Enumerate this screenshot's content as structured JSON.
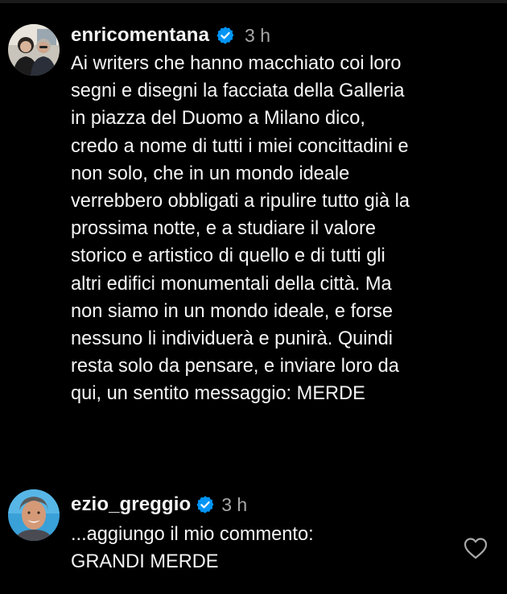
{
  "theme": {
    "background": "#000000",
    "text": "#f5f5f5",
    "muted": "#a8a8a8",
    "verified_blue": "#0095f6"
  },
  "comments": [
    {
      "username": "enricomentana",
      "verified": true,
      "verified_icon": "verified-badge-icon",
      "time": "3 h",
      "text": "Ai writers che hanno macchiato coi loro\nsegni e disegni la facciata della Galleria\nin piazza del Duomo a Milano dico,\ncredo a nome di tutti i miei concittadini e\nnon solo, che in un mondo ideale\nverrebbero obbligati a ripulire tutto già la\nprossima notte, e a studiare il valore\nstorico e artistico di quello e di tutti gli\naltri edifici monumentali della città. Ma\nnon siamo in un mondo ideale, e forse\nnessuno li individuerà e punirà. Quindi\nresta solo da pensare, e inviare loro da\nqui, un sentito messaggio: MERDE"
    },
    {
      "username": "ezio_greggio",
      "verified": true,
      "verified_icon": "verified-badge-icon",
      "time": "3 h",
      "text": "...aggiungo il mio commento:\nGRANDI MERDE",
      "like_icon": "heart-outline-icon"
    }
  ]
}
